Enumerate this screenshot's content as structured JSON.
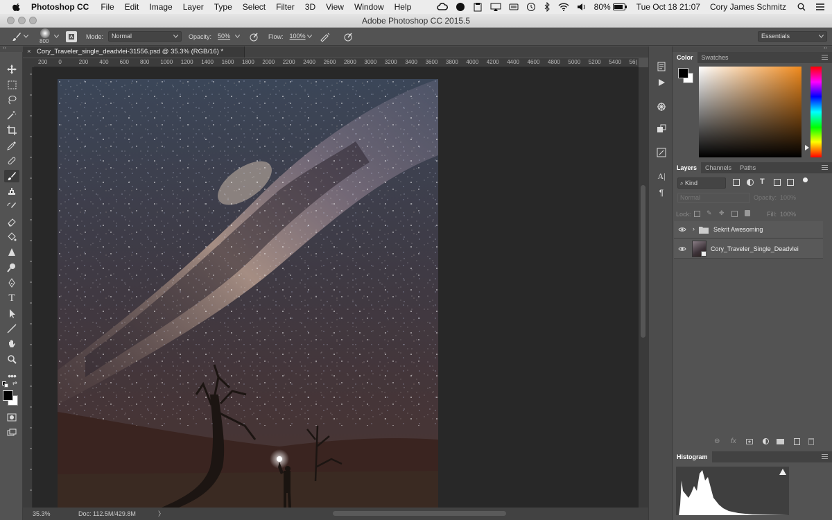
{
  "menubar": {
    "app": "Photoshop CC",
    "items": [
      "File",
      "Edit",
      "Image",
      "Layer",
      "Type",
      "Select",
      "Filter",
      "3D",
      "View",
      "Window",
      "Help"
    ],
    "battery": "80%",
    "clock": "Tue Oct 18  21:07",
    "user": "Cory James Schmitz"
  },
  "window": {
    "title": "Adobe Photoshop CC 2015.5"
  },
  "options": {
    "brush_size": "800",
    "mode_label": "Mode:",
    "mode_value": "Normal",
    "opacity_label": "Opacity:",
    "opacity_value": "50%",
    "flow_label": "Flow:",
    "flow_value": "100%",
    "workspace": "Essentials"
  },
  "document": {
    "tab_title": "Cory_Traveler_single_deadvlei-31556.psd @ 35.3% (RGB/16) *",
    "close": "×"
  },
  "ruler": {
    "h_ticks": [
      "200",
      "0",
      "200",
      "400",
      "600",
      "800",
      "1000",
      "1200",
      "1400",
      "1600",
      "1800",
      "2000",
      "2200",
      "2400",
      "2600",
      "2800",
      "3000",
      "3200",
      "3400",
      "3600",
      "3800",
      "4000",
      "4200",
      "4400",
      "4600",
      "4800",
      "5000",
      "5200",
      "5400",
      "56("
    ]
  },
  "status": {
    "zoom": "35.3%",
    "doc": "Doc: 112.5M/429.8M",
    "arrow": "〉"
  },
  "panels": {
    "color_tabs": [
      "Color",
      "Swatches"
    ],
    "layers_tabs": [
      "Layers",
      "Channels",
      "Paths"
    ],
    "filter_kind": "Kind",
    "blend_mode": "Normal",
    "opacity_label": "Opacity:",
    "opacity_value": "100%",
    "lock_label": "Lock:",
    "fill_label": "Fill:",
    "fill_value": "100%",
    "layers": [
      {
        "name": "Sekrit Awesoming",
        "type": "group"
      },
      {
        "name": "Cory_Traveler_Single_Deadvlei",
        "type": "smart-object"
      }
    ],
    "histogram_tab": "Histogram"
  }
}
